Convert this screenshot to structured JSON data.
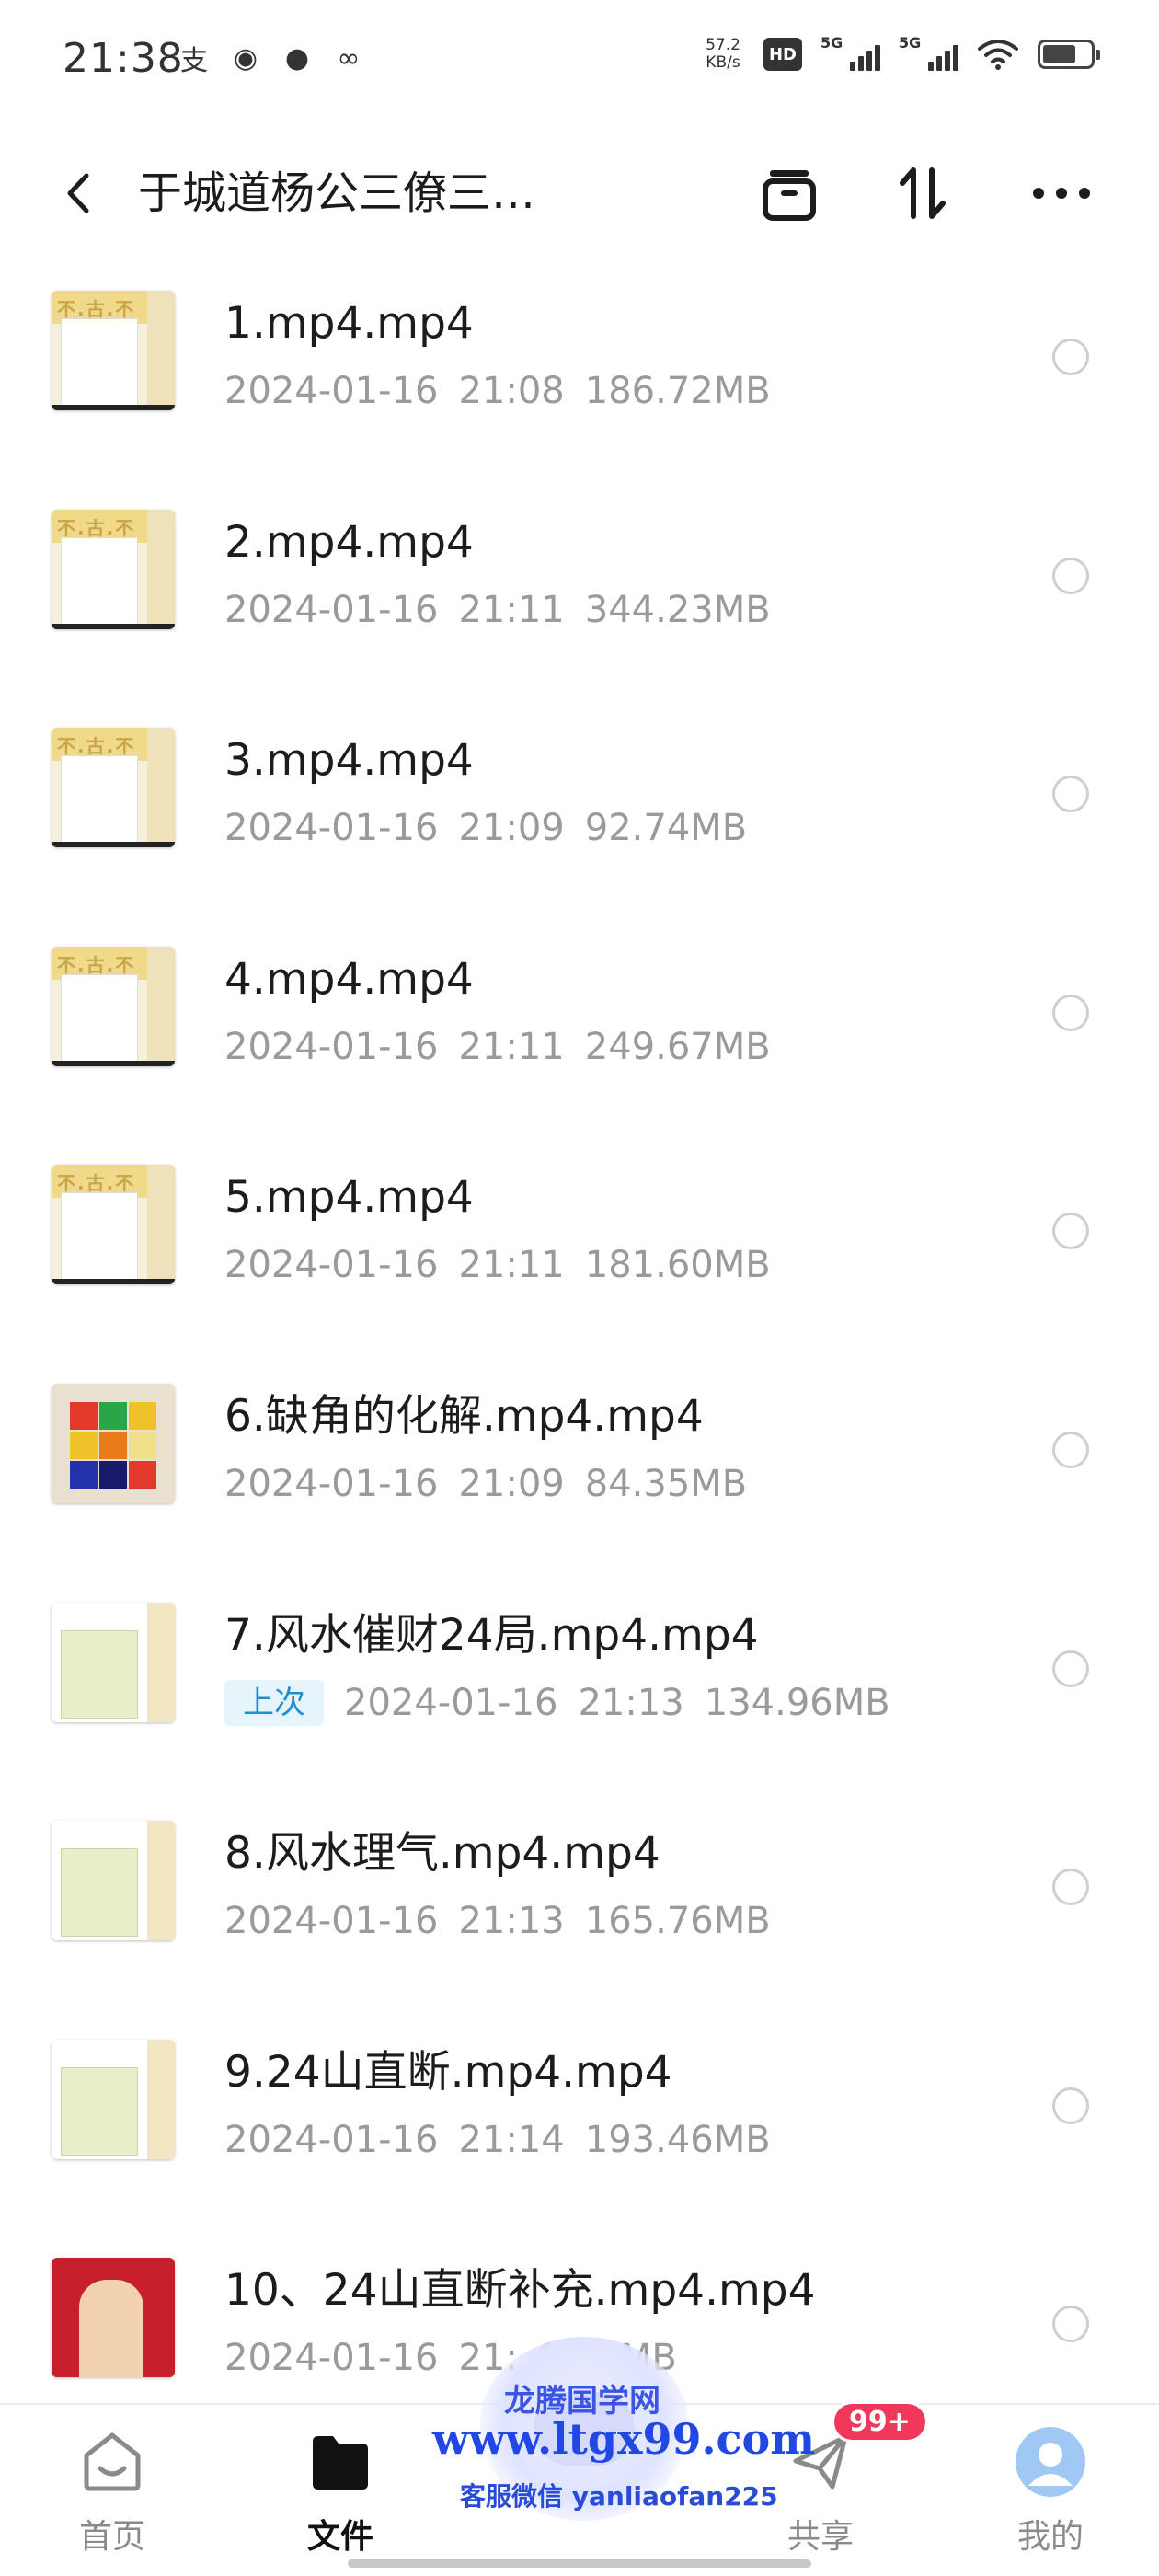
{
  "status_bar": {
    "time": "21:38",
    "app_icons": [
      "alipay-icon",
      "cat-app-icon",
      "message-bubble-icon",
      "link-app-icon"
    ],
    "app_glyphs": [
      "支",
      "◉",
      "●",
      "∞"
    ],
    "net_speed_value": "57.2",
    "net_speed_unit": "KB/s",
    "hd_label": "HD",
    "signal1_tag": "5G",
    "signal2_tag": "5G",
    "battery_level_pct": 70
  },
  "header": {
    "title": "于城道杨公三僚三…",
    "back_icon": "chevron-left-icon",
    "icons": [
      "archive-box-icon",
      "sort-arrows-icon",
      "more-dots-icon"
    ]
  },
  "files": [
    {
      "name": "1.mp4.mp4",
      "date": "2024-01-16",
      "time": "21:08",
      "size": "186.72MB",
      "thumb": "book"
    },
    {
      "name": "2.mp4.mp4",
      "date": "2024-01-16",
      "time": "21:11",
      "size": "344.23MB",
      "thumb": "book"
    },
    {
      "name": "3.mp4.mp4",
      "date": "2024-01-16",
      "time": "21:09",
      "size": "92.74MB",
      "thumb": "book"
    },
    {
      "name": "4.mp4.mp4",
      "date": "2024-01-16",
      "time": "21:11",
      "size": "249.67MB",
      "thumb": "book"
    },
    {
      "name": "5.mp4.mp4",
      "date": "2024-01-16",
      "time": "21:11",
      "size": "181.60MB",
      "thumb": "book"
    },
    {
      "name": "6.缺角的化解.mp4.mp4",
      "date": "2024-01-16",
      "time": "21:09",
      "size": "84.35MB",
      "thumb": "grid"
    },
    {
      "name": "7.风水催财24局.mp4.mp4",
      "badge": "上次",
      "date": "2024-01-16",
      "time": "21:13",
      "size": "134.96MB",
      "thumb": "photo"
    },
    {
      "name": "8.风水理气.mp4.mp4",
      "date": "2024-01-16",
      "time": "21:13",
      "size": "165.76MB",
      "thumb": "photo"
    },
    {
      "name": "9.24山直断.mp4.mp4",
      "date": "2024-01-16",
      "time": "21:14",
      "size": "193.46MB",
      "thumb": "photo"
    },
    {
      "name": "10、24山直断补充.mp4.mp4",
      "date": "2024-01-16",
      "time": "21:",
      "size": "9.01MB",
      "thumb": "red"
    }
  ],
  "thumb_banner_text": "不.古.不",
  "bottom_nav": {
    "items": [
      {
        "label": "首页",
        "icon": "home-face-icon",
        "active": false
      },
      {
        "label": "文件",
        "icon": "folder-icon",
        "active": true
      },
      {
        "label": "共享",
        "icon": "send-plane-icon",
        "active": false
      },
      {
        "label": "我的",
        "icon": "avatar-icon",
        "active": false
      }
    ],
    "share_badge": "99+"
  },
  "watermark": {
    "line1": "龙腾国学网",
    "line2": "www.ltgx99.com",
    "line3": "客服微信 yanliaofan225"
  },
  "colors": {
    "accent_blue": "#1f8fd0",
    "badge_red": "#f2385a",
    "meta_gray": "#9a9a9a"
  }
}
